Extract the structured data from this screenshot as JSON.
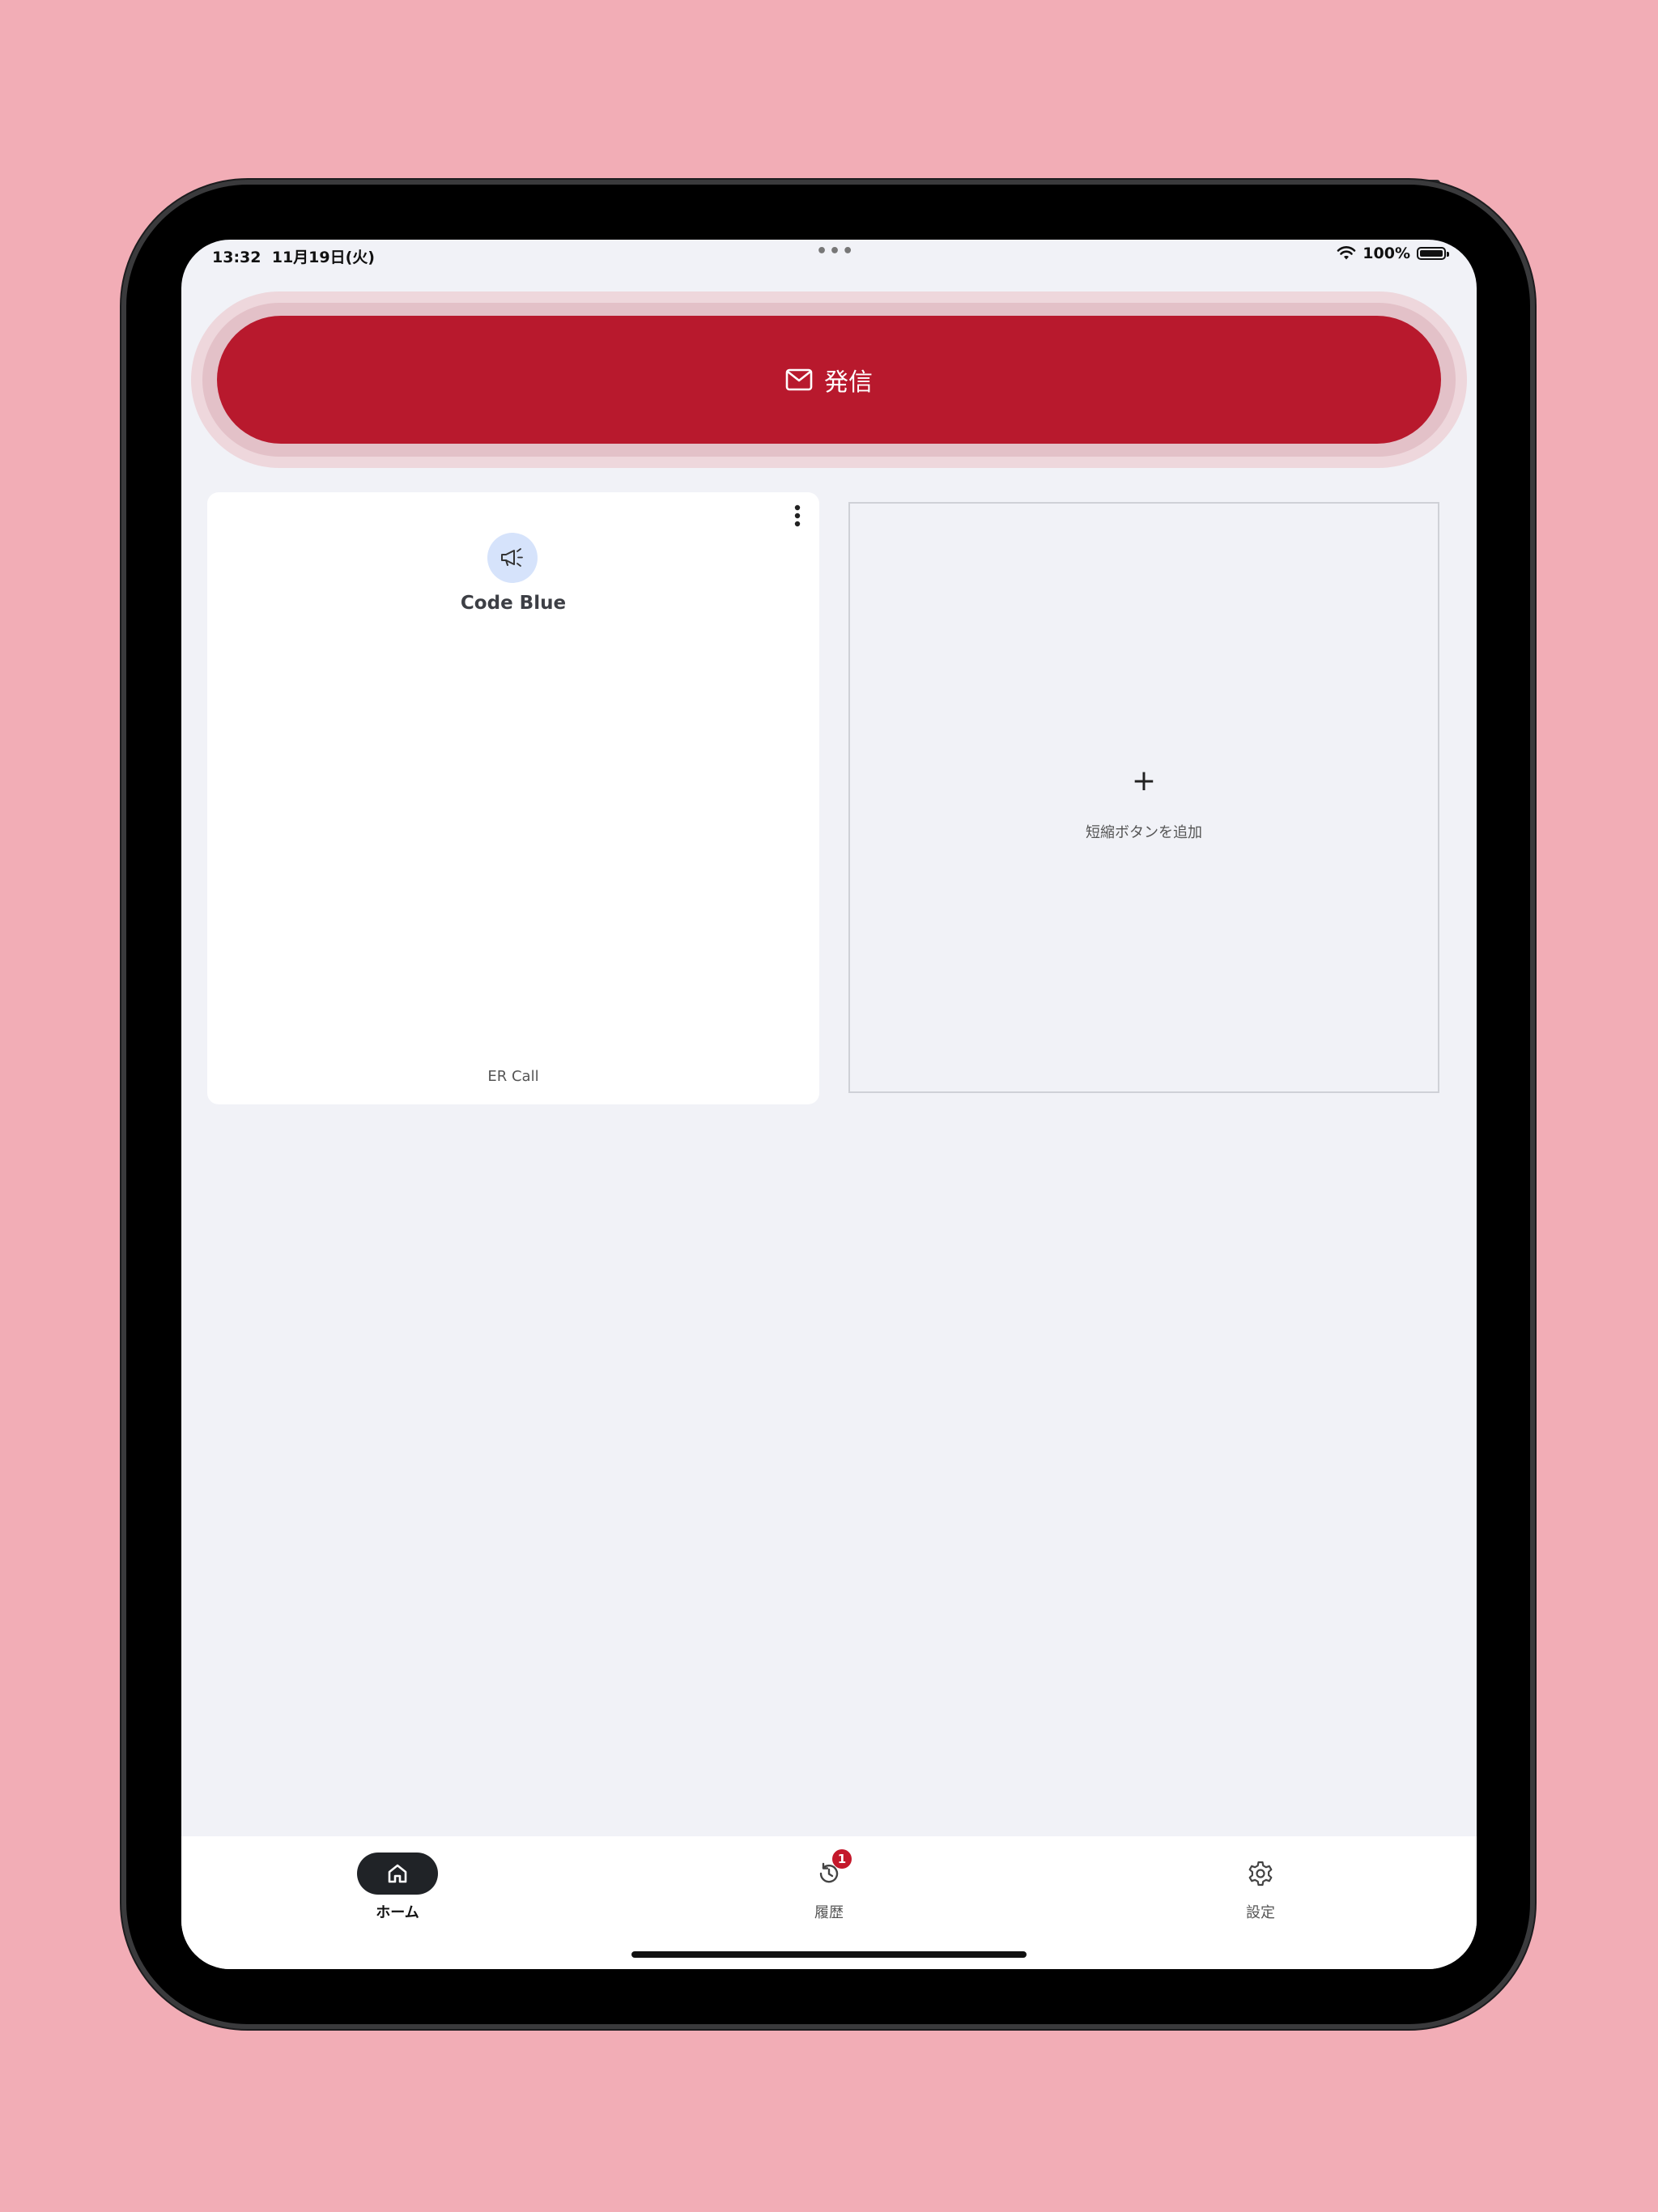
{
  "status_bar": {
    "time": "13:32",
    "date": "11月19日(火)",
    "dots": "•••",
    "battery_text": "100%"
  },
  "send_button": {
    "label": "発信",
    "icon": "mail-icon",
    "color": "#b8192d"
  },
  "cards": {
    "code_blue": {
      "icon": "megaphone-icon",
      "title": "Code Blue",
      "subtitle": "ER Call"
    },
    "add": {
      "icon": "plus-icon",
      "plus": "+",
      "label": "短縮ボタンを追加"
    }
  },
  "nav": {
    "items": [
      {
        "label": "ホーム",
        "icon": "home-icon",
        "active": true
      },
      {
        "label": "履歴",
        "icon": "history-icon",
        "badge": "1"
      },
      {
        "label": "設定",
        "icon": "gear-icon"
      }
    ]
  }
}
